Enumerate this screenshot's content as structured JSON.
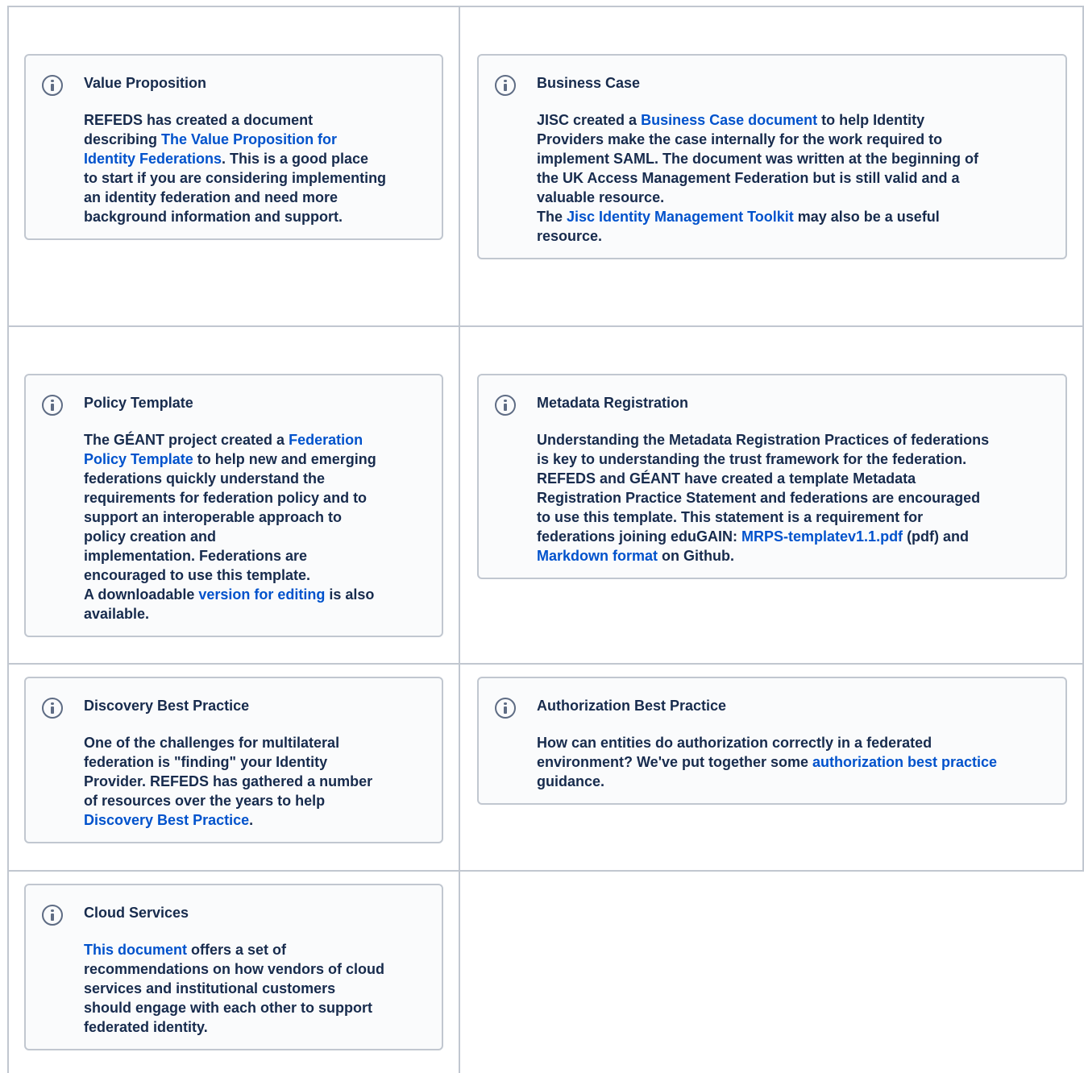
{
  "panels": {
    "value_proposition": {
      "icon": "info-icon",
      "title": "Value Proposition",
      "l1": "REFEDS has created a document",
      "l2a": "describing ",
      "l2link": "The Value Proposition for",
      "l3link": "Identity Federations",
      "l3b": ".  This is a good place",
      "l4": "to start if you are considering implementing",
      "l5": "an identity federation and need more",
      "l6": "background information and support."
    },
    "business_case": {
      "icon": "info-icon",
      "title": "Business Case",
      "l1a": "JISC created a ",
      "l1link": "Business Case document",
      "l1b": " to help Identity",
      "l2": "Providers make the case internally for the work required to",
      "l3": "implement SAML.  The document was written at the beginning of",
      "l4": "the UK Access Management Federation but is still valid and a",
      "l5": "valuable resource.",
      "l6a": "The ",
      "l6link": "Jisc Identity Management Toolkit",
      "l6b": " may also be a useful",
      "l7": "resource."
    },
    "policy_template": {
      "icon": "info-icon",
      "title": "Policy Template",
      "l1a": "The GÉANT project created a ",
      "l1link": "Federation",
      "l2link": "Policy Template",
      "l2b": " to help new and emerging",
      "l3": "federations quickly understand the",
      "l4": "requirements for federation policy and to",
      "l5": "support an interoperable approach to",
      "l6": "policy creation and",
      "l7": "implementation.  Federations are",
      "l8": "encouraged to use this template.",
      "l9a": "A downloadable ",
      "l9link": "version for editing",
      "l9b": " is also",
      "l10": "available."
    },
    "metadata_registration": {
      "icon": "info-icon",
      "title": "Metadata Registration",
      "l1": "Understanding the Metadata Registration Practices of federations",
      "l2": "is key to understanding the trust framework for the federation.",
      "l3": "REFEDS and GÉANT have created a template Metadata",
      "l4": "Registration Practice Statement and federations are encouraged",
      "l5": "to use this template.  This statement is a requirement for",
      "l6a": "federations joining eduGAIN:  ",
      "l6link": "MRPS-templatev1.1.pdf",
      "l6b": " (pdf) and",
      "l7link": "Markdown format",
      "l7b": " on Github."
    },
    "discovery": {
      "icon": "info-icon",
      "title": "Discovery Best Practice",
      "l1": "One of the challenges for multilateral",
      "l2": "federation is \"finding\" your Identity",
      "l3": "Provider.  REFEDS has gathered a number",
      "l4": "of resources over the years to help",
      "l5link": "Discovery Best Practice",
      "l5b": "."
    },
    "authorization": {
      "icon": "info-icon",
      "title": "Authorization Best Practice",
      "l1": "How can entities do authorization correctly in a federated",
      "l2a": "environment? We've put together some ",
      "l2link": "authorization best practice",
      "l3": "guidance."
    },
    "cloud": {
      "icon": "info-icon",
      "title": "Cloud Services",
      "l1link": "This document",
      "l1b": " offers a set of",
      "l2": "recommendations on how vendors of cloud",
      "l3": "services and institutional customers",
      "l4": "should engage with each other to support",
      "l5": "federated identity."
    }
  }
}
